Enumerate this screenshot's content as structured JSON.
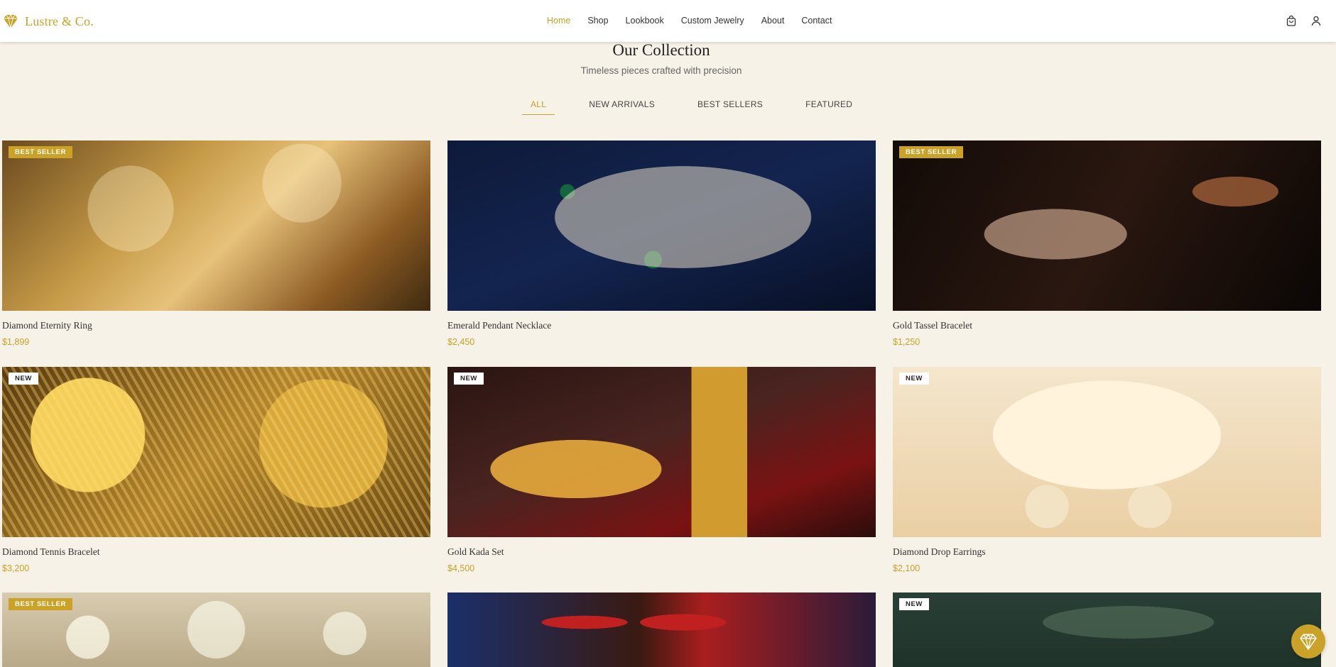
{
  "brand": {
    "name": "Lustre & Co.",
    "logo_icon": "diamond-icon",
    "accent": "#c9a227"
  },
  "nav": {
    "items": [
      {
        "label": "Home",
        "active": true
      },
      {
        "label": "Shop"
      },
      {
        "label": "Lookbook"
      },
      {
        "label": "Custom Jewelry"
      },
      {
        "label": "About"
      },
      {
        "label": "Contact"
      }
    ],
    "icons": [
      "shopping-bag-icon",
      "user-icon"
    ]
  },
  "collection": {
    "title": "Our Collection",
    "subtitle": "Timeless pieces crafted with precision",
    "tabs": [
      {
        "label": "ALL",
        "active": true
      },
      {
        "label": "NEW ARRIVALS"
      },
      {
        "label": "BEST SELLERS"
      },
      {
        "label": "FEATURED"
      }
    ]
  },
  "products": [
    {
      "name": "Diamond Eternity Ring",
      "price": "$1,899",
      "badge": "BEST SELLER"
    },
    {
      "name": "Emerald Pendant Necklace",
      "price": "$2,450",
      "badge": ""
    },
    {
      "name": "Gold Tassel Bracelet",
      "price": "$1,250",
      "badge": "BEST SELLER"
    },
    {
      "name": "Diamond Tennis Bracelet",
      "price": "$3,200",
      "badge": "NEW"
    },
    {
      "name": "Gold Kada Set",
      "price": "$4,500",
      "badge": "NEW"
    },
    {
      "name": "Diamond Drop Earrings",
      "price": "$2,100",
      "badge": "NEW"
    },
    {
      "name": "",
      "price": "",
      "badge": "BEST SELLER"
    },
    {
      "name": "",
      "price": "",
      "badge": ""
    },
    {
      "name": "",
      "price": "",
      "badge": "NEW"
    }
  ],
  "chat_button": {
    "icon": "diamond-icon"
  }
}
